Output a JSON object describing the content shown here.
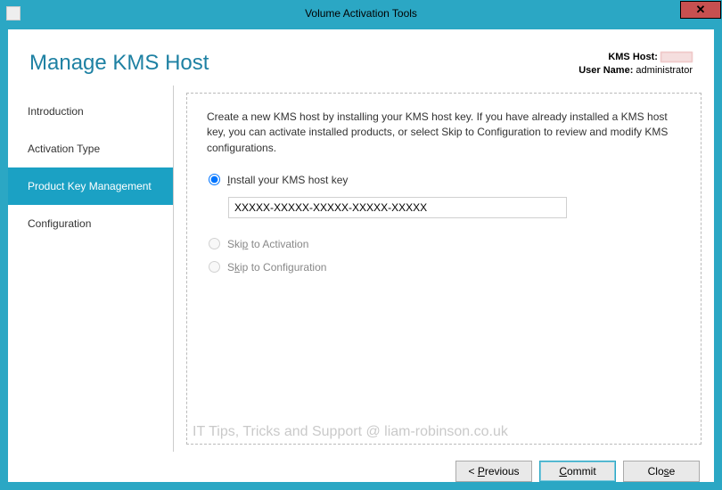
{
  "window": {
    "title": "Volume Activation Tools",
    "close_glyph": "✕"
  },
  "header": {
    "page_title": "Manage KMS Host",
    "kms_host_label": "KMS Host:",
    "user_name_label": "User Name:",
    "user_name_value": "administrator"
  },
  "sidebar": {
    "items": [
      {
        "label": "Introduction",
        "active": false
      },
      {
        "label": "Activation Type",
        "active": false
      },
      {
        "label": "Product Key Management",
        "active": true
      },
      {
        "label": "Configuration",
        "active": false
      }
    ]
  },
  "panel": {
    "description": "Create a new KMS host by installing your KMS host key. If you have already installed a KMS host key, you can activate installed products, or select Skip to Configuration to review and modify KMS configurations.",
    "options": {
      "install": {
        "prefix_underline": "I",
        "rest": "nstall your KMS host key",
        "checked": true,
        "enabled": true
      },
      "skip_activation": {
        "prefix": "Ski",
        "underline": "p",
        "rest": " to Activation",
        "checked": false,
        "enabled": false
      },
      "skip_config": {
        "prefix": "S",
        "underline": "k",
        "rest": "ip to Configuration",
        "checked": false,
        "enabled": false
      }
    },
    "key_value": "XXXXX-XXXXX-XXXXX-XXXXX-XXXXX"
  },
  "buttons": {
    "previous_prefix": "< ",
    "previous_underline": "P",
    "previous_rest": "revious",
    "commit_underline": "C",
    "commit_rest": "ommit",
    "close_prefix": "Clo",
    "close_underline": "s",
    "close_rest": "e"
  },
  "watermark": "IT Tips, Tricks and Support @ liam-robinson.co.uk"
}
